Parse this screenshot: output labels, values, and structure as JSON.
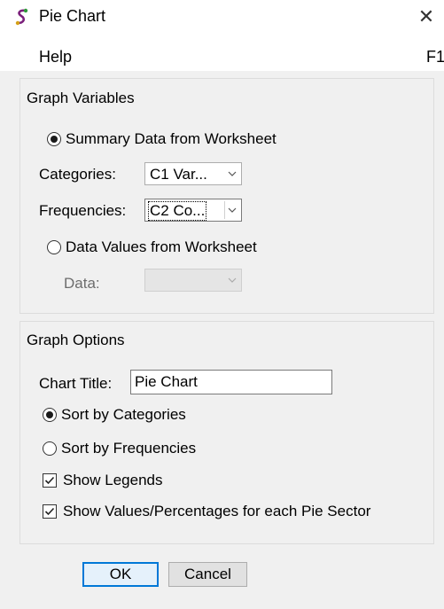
{
  "window": {
    "title": "Pie Chart",
    "icon": "app-icon",
    "close_glyph": "✕"
  },
  "menu": {
    "help_label": "Help",
    "help_shortcut": "F1"
  },
  "graph_variables": {
    "caption": "Graph Variables",
    "summary_option": "Summary Data from Worksheet",
    "summary_selected": true,
    "categories_label": "Categories:",
    "categories_value": "C1  Var...",
    "frequencies_label": "Frequencies:",
    "frequencies_value": "C2  Co...",
    "data_values_option": "Data Values from Worksheet",
    "data_values_selected": false,
    "data_label": "Data:",
    "data_value": ""
  },
  "graph_options": {
    "caption": "Graph Options",
    "chart_title_label": "Chart Title:",
    "chart_title_value": "Pie Chart",
    "sort_categories": "Sort by Categories",
    "sort_categories_selected": true,
    "sort_frequencies": "Sort by Frequencies",
    "sort_frequencies_selected": false,
    "show_legends": "Show Legends",
    "show_legends_checked": true,
    "show_values": "Show Values/Percentages for each Pie Sector",
    "show_values_checked": true
  },
  "buttons": {
    "ok": "OK",
    "cancel": "Cancel"
  },
  "colors": {
    "accent": "#0078d7",
    "window_bg": "#f0f0f0"
  }
}
